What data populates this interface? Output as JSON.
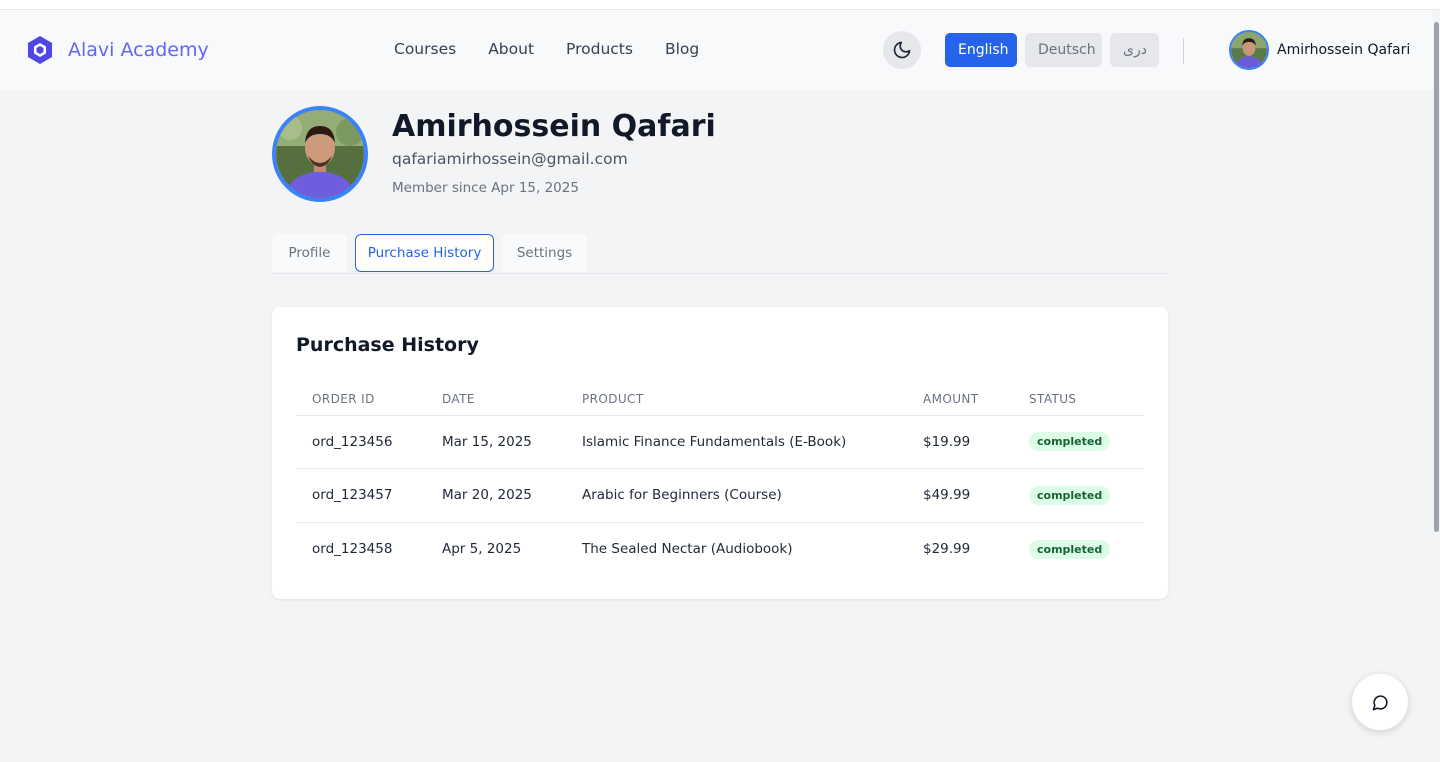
{
  "brand": {
    "name": "Alavi Academy",
    "logo_icon": "hexagon-logo-icon"
  },
  "nav": {
    "items": [
      {
        "label": "Courses"
      },
      {
        "label": "About"
      },
      {
        "label": "Products"
      },
      {
        "label": "Blog"
      }
    ]
  },
  "theme_toggle": {
    "icon": "moon-icon"
  },
  "languages": [
    {
      "label": "English",
      "active": true
    },
    {
      "label": "Deutsch",
      "active": false
    },
    {
      "label": "دری",
      "active": false
    }
  ],
  "user": {
    "name": "Amirhossein Qafari"
  },
  "profile": {
    "name": "Amirhossein Qafari",
    "email": "qafariamirhossein@gmail.com",
    "member_since": "Member since Apr 15, 2025"
  },
  "tabs": [
    {
      "label": "Profile",
      "active": false
    },
    {
      "label": "Purchase History",
      "active": true
    },
    {
      "label": "Settings",
      "active": false
    }
  ],
  "purchase_history": {
    "title": "Purchase History",
    "columns": [
      "ORDER ID",
      "DATE",
      "PRODUCT",
      "AMOUNT",
      "STATUS"
    ],
    "rows": [
      {
        "order_id": "ord_123456",
        "date": "Mar 15, 2025",
        "product": "Islamic Finance Fundamentals (E-Book)",
        "amount": "$19.99",
        "status": "completed"
      },
      {
        "order_id": "ord_123457",
        "date": "Mar 20, 2025",
        "product": "Arabic for Beginners (Course)",
        "amount": "$49.99",
        "status": "completed"
      },
      {
        "order_id": "ord_123458",
        "date": "Apr 5, 2025",
        "product": "The Sealed Nectar (Audiobook)",
        "amount": "$29.99",
        "status": "completed"
      }
    ]
  },
  "chat": {
    "icon": "chat-bubble-icon"
  },
  "colors": {
    "primary": "#2563eb",
    "brand": "#6366f1",
    "success_bg": "#dcfce7",
    "success_text": "#166534"
  }
}
